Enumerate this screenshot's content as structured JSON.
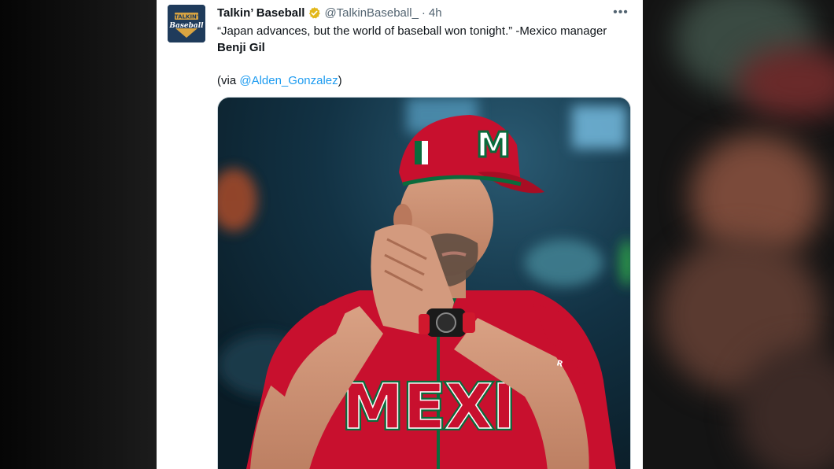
{
  "tweet": {
    "author_name": "Talkin’ Baseball",
    "handle": "@TalkinBaseball_",
    "separator": "·",
    "time": "4h",
    "text_part1": "“Japan advances, but the world of baseball won tonight.” -Mexico manager ",
    "text_bold": "Benji Gil",
    "via_prefix": "(via ",
    "via_link": "@Alden_Gonzalez",
    "via_suffix": ")",
    "more_label": "•••"
  },
  "avatar": {
    "logo_top": "TALKIN'",
    "logo_bottom": "Baseball"
  },
  "photo": {
    "jersey_text": "MEXI",
    "cap_letter": "M"
  },
  "colors": {
    "verified_badge": "#e2b719",
    "link": "#1d9bf0",
    "jersey_red": "#c8102e",
    "jersey_green": "#0a6b3c"
  }
}
